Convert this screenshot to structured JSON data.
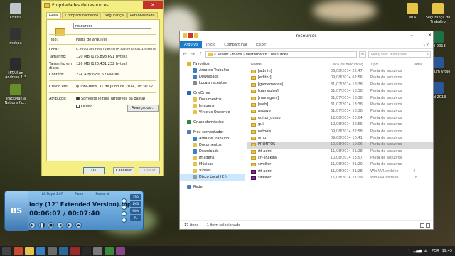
{
  "desktop": {
    "icons": [
      {
        "label": "Lixeira",
        "icon": "recycle-bin-icon",
        "color": "#bfc6cf"
      },
      {
        "label": "mohpa",
        "icon": "app-icon",
        "color": "#333333"
      },
      {
        "label": "MTA San Andreas 1.3",
        "icon": "mta-icon",
        "color": "#2b2b2b"
      },
      {
        "label": "TrackMania Nations Fo...",
        "icon": "trackmania-icon",
        "color": "#6a8c2a"
      }
    ],
    "right_icons": [
      {
        "label": "MTA",
        "icon": "folder-icon",
        "color": "#e8c34a"
      },
      {
        "label": "Segurança do Trabalho",
        "icon": "folder-icon",
        "color": "#e8c34a"
      },
      {
        "label": "cel 2013",
        "icon": "excel-icon",
        "color": "#1e7145"
      },
      {
        "label": "mculum Vitae",
        "icon": "word-icon",
        "color": "#2b579a"
      },
      {
        "label": "ord 2013",
        "icon": "word-icon",
        "color": "#2b579a"
      }
    ]
  },
  "properties": {
    "title": "Propriedades de resources",
    "close": "✕",
    "tabs": [
      "Geral",
      "Compartilhamento",
      "Segurança",
      "Personalizado"
    ],
    "name": "resources",
    "rows": [
      {
        "label": "Tipo:",
        "value": "Pasta de arquivos"
      },
      {
        "label": "Local:",
        "value": "C:\\Program Files (x86)\\MTA San Andreas 1.4\\serve"
      },
      {
        "label": "Tamanho:",
        "value": "120 MB (125.898.691 bytes)"
      },
      {
        "label": "Tamanho em disco:",
        "value": "120 MB (126.431.232 bytes)"
      },
      {
        "label": "Contém:",
        "value": "274 Arquivos, 52 Pastas"
      },
      {
        "label": "Criado em:",
        "value": "quinta-feira, 31 de julho de 2014, 18:38:52"
      }
    ],
    "attributes_label": "Atributos:",
    "readonly_label": "Somente leitura (arquivos da pasta)",
    "hidden_label": "Oculto",
    "advanced_button": "Avançados...",
    "ok_button": "OK",
    "cancel_button": "Cancelar",
    "apply_button": "Aplicar"
  },
  "explorer": {
    "title": "resources",
    "ribbon": [
      "Arquivo",
      "Início",
      "Compartilhar",
      "Exibir"
    ],
    "path_parts": [
      "server",
      "mods",
      "deathmatch",
      "resources"
    ],
    "search_placeholder": "Pesquisar resources",
    "nav": [
      {
        "label": "Favoritos",
        "level": 1,
        "color": "#e6b422"
      },
      {
        "label": "Área de Trabalho",
        "level": 2,
        "color": "#3b7fc4"
      },
      {
        "label": "Downloads",
        "level": 2,
        "color": "#3b7fc4"
      },
      {
        "label": "Locais recentes",
        "level": 2,
        "color": "#888888"
      },
      {
        "label": "OneDrive",
        "level": 1,
        "color": "#1e66c8"
      },
      {
        "label": "Documentos",
        "level": 2,
        "color": "#e8c34a"
      },
      {
        "label": "Imagens",
        "level": 2,
        "color": "#e8c34a"
      },
      {
        "label": "Vinicius Onedrive",
        "level": 2,
        "color": "#e8c34a"
      },
      {
        "label": "Grupo doméstico",
        "level": 1,
        "color": "#2c8a3a"
      },
      {
        "label": "Meu computador",
        "level": 1,
        "color": "#4c7fb0"
      },
      {
        "label": "Área de Trabalho",
        "level": 2,
        "color": "#3b7fc4"
      },
      {
        "label": "Documentos",
        "level": 2,
        "color": "#e8c34a"
      },
      {
        "label": "Downloads",
        "level": 2,
        "color": "#3b7fc4"
      },
      {
        "label": "Imagens",
        "level": 2,
        "color": "#e8c34a"
      },
      {
        "label": "Músicas",
        "level": 2,
        "color": "#e8c34a"
      },
      {
        "label": "Vídeos",
        "level": 2,
        "color": "#e8c34a"
      },
      {
        "label": "Disco Local (C:)",
        "level": 2,
        "color": "#999999",
        "selected": true
      },
      {
        "label": "Rede",
        "level": 1,
        "color": "#4c7fb0"
      }
    ],
    "columns": [
      "Nome",
      "Data de modificaç...",
      "Tipo",
      "Tama"
    ],
    "files": [
      {
        "name": "[admin]",
        "date": "06/08/2014 22:47",
        "type": "Pasta de arquivos",
        "size": "",
        "kind": "folder"
      },
      {
        "name": "[editor]",
        "date": "09/08/2014 02:56",
        "type": "Pasta de arquivos",
        "size": "",
        "kind": "folder"
      },
      {
        "name": "[gamemodes]",
        "date": "31/07/2014 18:38",
        "type": "Pasta de arquivos",
        "size": "",
        "kind": "folder"
      },
      {
        "name": "[gameplay]",
        "date": "31/07/2014 18:38",
        "type": "Pasta de arquivos",
        "size": "",
        "kind": "folder"
      },
      {
        "name": "[managers]",
        "date": "31/07/2014 18:38",
        "type": "Pasta de arquivos",
        "size": "",
        "kind": "folder"
      },
      {
        "name": "[web]",
        "date": "31/07/2014 18:38",
        "type": "Pasta de arquivos",
        "size": "",
        "kind": "folder"
      },
      {
        "name": "asdave",
        "date": "31/07/2014 18:38",
        "type": "Pasta de arquivos",
        "size": "",
        "kind": "folder"
      },
      {
        "name": "editor_dump",
        "date": "12/08/2014 20:04",
        "type": "Pasta de arquivos",
        "size": "",
        "kind": "folder"
      },
      {
        "name": "gui",
        "date": "12/08/2014 22:56",
        "type": "Pasta de arquivos",
        "size": "",
        "kind": "folder"
      },
      {
        "name": "netools",
        "date": "09/08/2014 22:58",
        "type": "Pasta de arquivos",
        "size": "",
        "kind": "folder"
      },
      {
        "name": "omg",
        "date": "09/08/2014 16:41",
        "type": "Pasta de arquivos",
        "size": "",
        "kind": "folder"
      },
      {
        "name": "PRONTOS",
        "date": "10/08/2014 19:06",
        "type": "Pasta de arquivos",
        "size": "",
        "kind": "folder",
        "selected": true
      },
      {
        "name": "rtf-admi",
        "date": "11/08/2014 21:28",
        "type": "Pasta de arquivos",
        "size": "",
        "kind": "folder"
      },
      {
        "name": "ch-shakira",
        "date": "10/08/2014 13:57",
        "type": "Pasta de arquivos",
        "size": "",
        "kind": "folder"
      },
      {
        "name": "swelter",
        "date": "11/08/2014 21:29",
        "type": "Pasta de arquivos",
        "size": "",
        "kind": "folder"
      },
      {
        "name": "rtf-admi",
        "date": "11/08/2014 21:28",
        "type": "WinRAR archive",
        "size": "4",
        "kind": "rar"
      },
      {
        "name": "swelter",
        "date": "11/08/2014 21:29",
        "type": "WinRAR archive",
        "size": "16",
        "kind": "rar"
      }
    ],
    "status_count": "17 itens",
    "status_sel": "1 item selecionado"
  },
  "bsplayer": {
    "logo": "BS",
    "top_labels": [
      "BS.Player 2.67",
      "Pause",
      "Repeat all"
    ],
    "title": "lody (12\" Extended Version).mp",
    "time": "00:06:07 / 00:07:40",
    "side_buttons": [
      "STO",
      "DVD",
      "MOV",
      "PL"
    ]
  },
  "taskbar": {
    "apps": [
      {
        "icon": "start-icon",
        "color": "#444444"
      },
      {
        "icon": "chrome-icon",
        "color": "#c94b2c"
      },
      {
        "icon": "explorer-icon",
        "color": "#e8c34a"
      },
      {
        "icon": "app-icon",
        "color": "#3a7ebf"
      },
      {
        "icon": "app-icon",
        "color": "#6b6b6b"
      },
      {
        "icon": "app-icon",
        "color": "#2a6a9a"
      },
      {
        "icon": "app-icon",
        "color": "#9a2a2a"
      },
      {
        "icon": "app-icon",
        "color": "#2a2a2a"
      },
      {
        "icon": "app-icon",
        "color": "#7a7a7a"
      },
      {
        "icon": "app-icon",
        "color": "#3a8a3a"
      },
      {
        "icon": "app-icon",
        "color": "#884488"
      }
    ],
    "lang": "POR",
    "time": "19:43"
  }
}
